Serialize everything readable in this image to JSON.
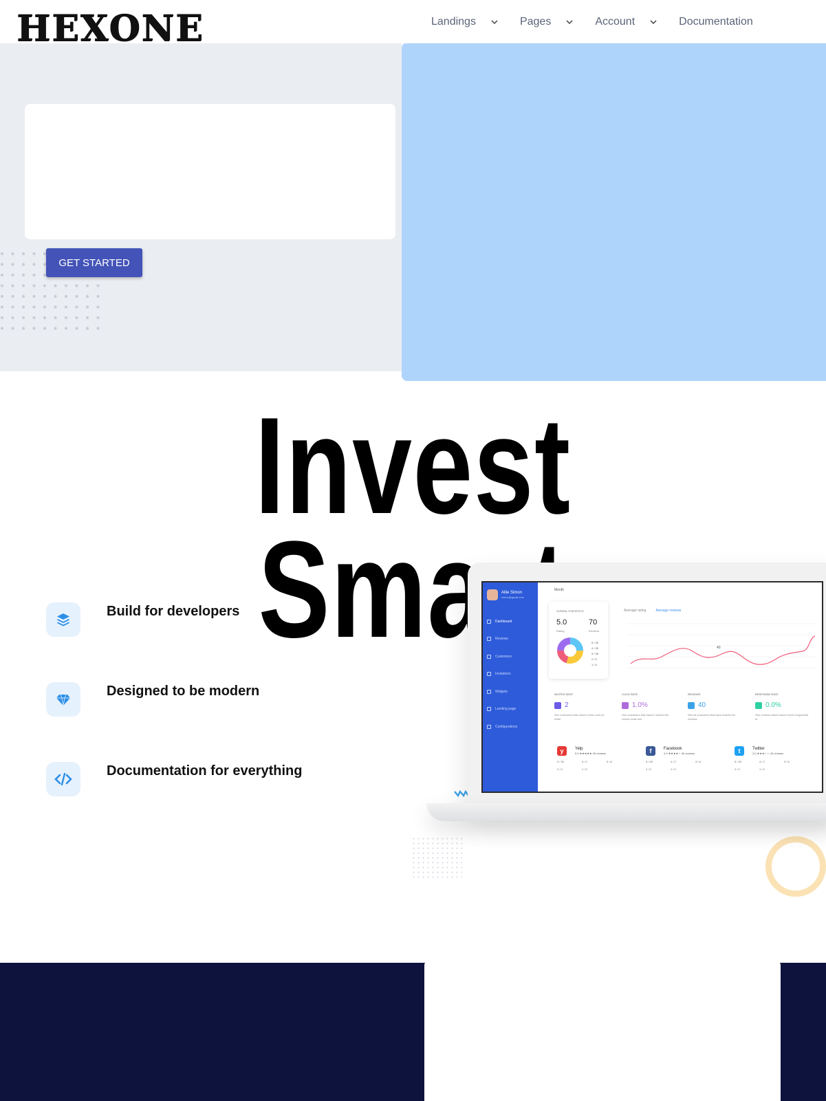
{
  "header": {
    "logo": "HEXONE",
    "nav": [
      {
        "label": "Landings",
        "has_dropdown": true
      },
      {
        "label": "Pages",
        "has_dropdown": true
      },
      {
        "label": "Account",
        "has_dropdown": true
      },
      {
        "label": "Documentation",
        "has_dropdown": false
      }
    ]
  },
  "hero": {
    "cta_label": "GET STARTED"
  },
  "headline": "Invest Smart",
  "features": [
    {
      "icon": "layers-icon",
      "label": "Build for developers"
    },
    {
      "icon": "diamond-icon",
      "label": "Designed to be modern"
    },
    {
      "icon": "code-icon",
      "label": "Documentation for everything"
    }
  ],
  "dashboard": {
    "user_name": "Allie Simon",
    "user_email": "simon@gmail.com",
    "menu": [
      "Dashboard",
      "Reviews",
      "Customers",
      "Invitations",
      "Widgets",
      "Landing page",
      "Configurations"
    ],
    "period": "Month",
    "stat_title": "OVERAL STATISTICS",
    "rating": "5.0",
    "rating_label": "Rating",
    "reviews": "70",
    "reviews_label": "Reviews",
    "legend": [
      "5 / 30",
      "4 / 30",
      "3 / 30",
      "2 / 5",
      "1 / 5"
    ],
    "tabs": [
      "Average rating",
      "Average reviews"
    ],
    "kpis": [
      {
        "label": "INVITES SENT",
        "value": "2",
        "desc": "See customers that haven't been sent an invite",
        "color": "#6c5ce7"
      },
      {
        "label": "CLICK RATE",
        "value": "1.0%",
        "desc": "See customers that haven't clicked the review invite link",
        "color": "#b06bdb"
      },
      {
        "label": "REVIEWS",
        "value": "40",
        "desc": "See all customers that have leaved the reviews",
        "color": "#3aa3e8"
      },
      {
        "label": "RESPONSE RATE",
        "value": "0.0%",
        "desc": "See reviews which haven't been responded to",
        "color": "#2fd0a3"
      }
    ],
    "platforms": [
      {
        "name": "Yelp",
        "rating": "5.0 ★★★★★ 40 reviews",
        "row1": [
          "5 / 30",
          "4 / 2",
          "3 / 8"
        ],
        "row2": [
          "2 / 0",
          "1 / 0"
        ],
        "color": "#e53935",
        "glyph": "y"
      },
      {
        "name": "Facebook",
        "rating": "4.0 ★★★★☆ 40 reviews",
        "row1": [
          "5 / 30",
          "4 / 2",
          "3 / 8"
        ],
        "row2": [
          "2 / 0",
          "1 / 0"
        ],
        "color": "#3b5998",
        "glyph": "f"
      },
      {
        "name": "Twitter",
        "rating": "3.0 ★★★☆☆ 40 reviews",
        "row1": [
          "5 / 30",
          "4 / 2",
          "3 / 6"
        ],
        "row2": [
          "2 / 0",
          "1 / 0"
        ],
        "color": "#1da1f2",
        "glyph": "t"
      }
    ],
    "chart_point_label": "40"
  },
  "colors": {
    "accent": "#4353b8",
    "hero_panel": "#afd4fb",
    "footer": "#0e133e"
  }
}
